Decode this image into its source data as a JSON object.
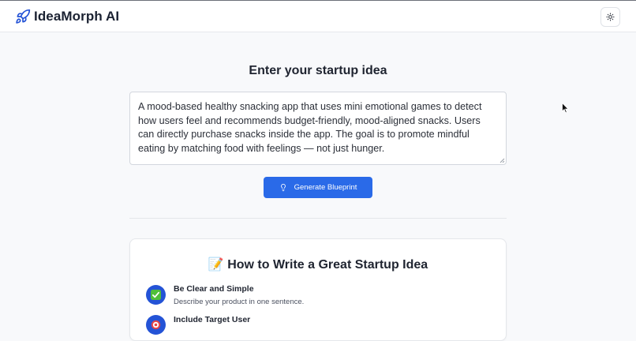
{
  "header": {
    "brand": "IdeaMorph AI",
    "logo_icon": "rocket-icon",
    "theme_icon": "sun-icon"
  },
  "main": {
    "heading": "Enter your startup idea",
    "idea_text": "A mood-based healthy snacking app that uses mini emotional games to detect how users feel and recommends budget-friendly, mood-aligned snacks. Users can directly purchase snacks inside the app. The goal is to promote mindful eating by matching food with feelings — not just hunger.",
    "generate_button": "Generate Blueprint",
    "generate_icon": "lightbulb-icon"
  },
  "tips": {
    "title_emoji": "📝",
    "title": "How to Write a Great Startup Idea",
    "items": [
      {
        "icon": "check-mark-icon",
        "title": "Be Clear and Simple",
        "desc": "Describe your product in one sentence."
      },
      {
        "icon": "target-icon",
        "title": "Include Target User",
        "desc": ""
      }
    ]
  },
  "colors": {
    "accent": "#2a6ae8",
    "tip_icon_bg": "#2453d6",
    "background": "#f8f9fb"
  }
}
